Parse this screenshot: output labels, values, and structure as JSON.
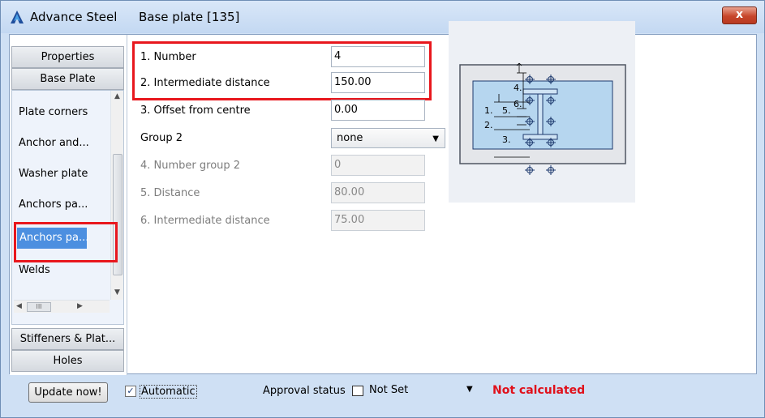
{
  "window": {
    "app_name": "Advance Steel",
    "title": "Base plate [135]",
    "close_label": "x"
  },
  "nav": {
    "top_buttons": [
      "Properties",
      "Base Plate"
    ],
    "items": [
      "Plate corners",
      "Anchor and...",
      "Washer plate",
      "Anchors pa...",
      "Anchors pa...",
      "Welds"
    ],
    "selected_index": 4,
    "bottom_buttons": [
      "Stiffeners & Plat...",
      "Holes"
    ],
    "hscroll_thumb": "III"
  },
  "fields": {
    "number": {
      "label": "1. Number",
      "value": "4"
    },
    "intermediate_distance": {
      "label": "2. Intermediate distance",
      "value": "150.00"
    },
    "offset_from_centre": {
      "label": "3. Offset from centre",
      "value": "0.00"
    },
    "group2": {
      "label": "Group 2",
      "value": "none"
    },
    "number_group2": {
      "label": "4. Number group 2",
      "value": "0"
    },
    "distance": {
      "label": "5. Distance",
      "value": "80.00"
    },
    "intermediate_distance2": {
      "label": "6. Intermediate distance",
      "value": "75.00"
    }
  },
  "diagram": {
    "labels": [
      "4.",
      "6.",
      "1.",
      "5.",
      "2.",
      "3."
    ],
    "colors": {
      "plate": "#b6d6ef",
      "plate_border": "#1e3a6e",
      "outer": "#e4e6ea",
      "outer_border": "#4e5562"
    }
  },
  "footer": {
    "update_button": "Update now!",
    "automatic_label": "Automatic",
    "automatic_checked": true,
    "approval_label": "Approval status",
    "approval_value": "Not Set",
    "status_text": "Not calculated"
  },
  "colors": {
    "highlight_border": "#e8171d",
    "selection": "#4c8fe0",
    "status_red": "#e0101a"
  }
}
